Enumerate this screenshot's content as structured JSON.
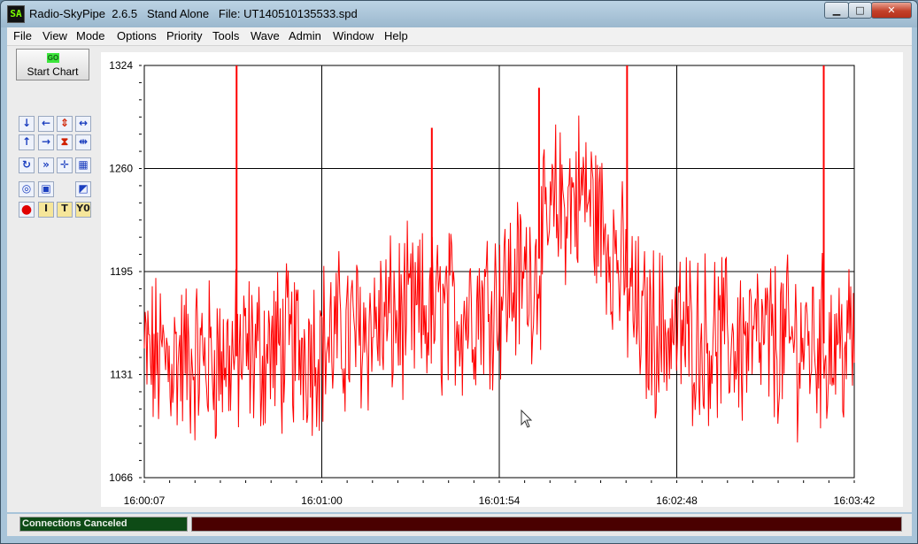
{
  "window": {
    "title": "Radio-SkyPipe  2.6.5   Stand Alone   File: UT140510135533.spd",
    "app_icon_text": "SA",
    "minimize_glyph": "▁",
    "maximize_glyph": "□",
    "close_glyph": "✕"
  },
  "menu": [
    "File",
    "View",
    "Mode",
    "Options",
    "Priority",
    "Tools",
    "Wave",
    "Admin",
    "Window",
    "Help"
  ],
  "toolbar": {
    "start_badge": "GO",
    "start_label": "Start Chart",
    "icons": [
      {
        "name": "shift-down-icon",
        "glyph": "↓"
      },
      {
        "name": "shift-left-icon",
        "glyph": "←"
      },
      {
        "name": "expand-vertical-icon",
        "glyph": "⇕"
      },
      {
        "name": "expand-horizontal-icon",
        "glyph": "↔"
      },
      {
        "name": "shift-up-icon",
        "glyph": "↑"
      },
      {
        "name": "shift-right-icon",
        "glyph": "→"
      },
      {
        "name": "compress-vertical-icon",
        "glyph": "⧗"
      },
      {
        "name": "compress-horizontal-icon",
        "glyph": "⇹"
      },
      {
        "name": "refresh-icon",
        "glyph": "↻"
      },
      {
        "name": "fast-forward-icon",
        "glyph": "»"
      },
      {
        "name": "crosshair-icon",
        "glyph": "✛"
      },
      {
        "name": "zoom-box-icon",
        "glyph": "▦"
      },
      {
        "name": "fit-all-icon",
        "glyph": "◎"
      },
      {
        "name": "select-box-icon",
        "glyph": "▣"
      },
      {
        "name": "cursor-mark-icon",
        "glyph": "◩"
      },
      {
        "name": "record-icon",
        "glyph": "●"
      },
      {
        "name": "insert-text-icon",
        "glyph": "I"
      },
      {
        "name": "title-text-icon",
        "glyph": "T"
      },
      {
        "name": "y-zero-icon",
        "glyph": "Y0"
      }
    ]
  },
  "colors": {
    "trace": "#ff0000",
    "status_left_bg": "#0e4b16",
    "status_right_bg": "#4a0000"
  },
  "chart_data": {
    "type": "line",
    "ylim": [
      1066,
      1324
    ],
    "y_ticks": [
      "1324",
      "1260",
      "1195",
      "1131",
      "1066"
    ],
    "x_ticks": [
      "16:00:07",
      "16:01:00",
      "16:01:54",
      "16:02:48",
      "16:03:42"
    ],
    "grid": true,
    "series": [
      {
        "color": "#ff0000",
        "samples_per_trace": 800,
        "noise_amplitude": 45,
        "baseline_profile": [
          [
            0.0,
            1140
          ],
          [
            0.1,
            1140
          ],
          [
            0.25,
            1150
          ],
          [
            0.35,
            1165
          ],
          [
            0.45,
            1170
          ],
          [
            0.55,
            1195
          ],
          [
            0.58,
            1235
          ],
          [
            0.62,
            1245
          ],
          [
            0.66,
            1210
          ],
          [
            0.7,
            1160
          ],
          [
            0.85,
            1150
          ],
          [
            1.0,
            1150
          ]
        ],
        "spikes": [
          {
            "x_frac": 0.13,
            "value": 1324
          },
          {
            "x_frac": 0.405,
            "value": 1285
          },
          {
            "x_frac": 0.556,
            "value": 1310
          },
          {
            "x_frac": 0.68,
            "value": 1324
          },
          {
            "x_frac": 0.957,
            "value": 1324
          }
        ]
      }
    ]
  },
  "status": {
    "left": "Connections Canceled",
    "right": ""
  }
}
